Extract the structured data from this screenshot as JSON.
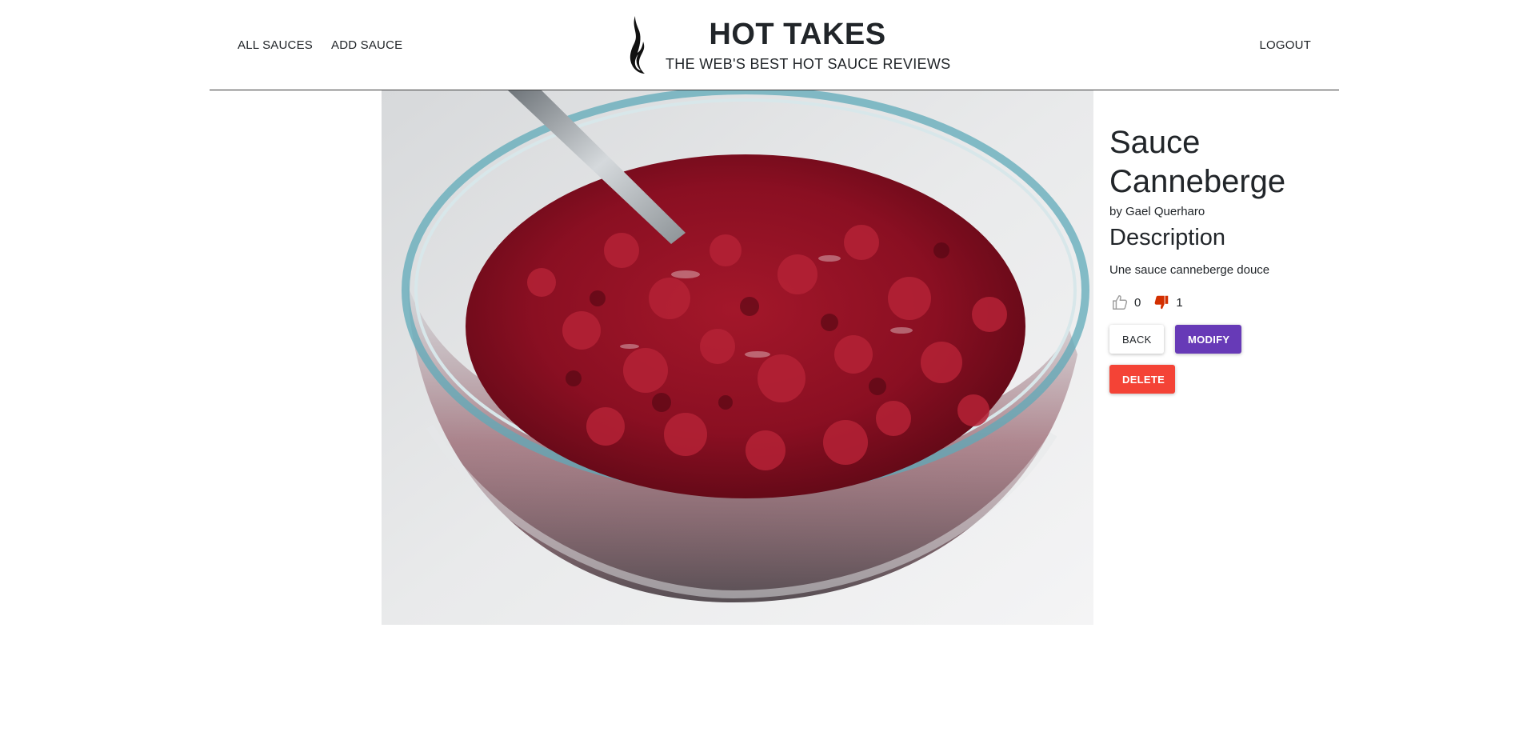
{
  "header": {
    "nav": {
      "all_sauces": "ALL SAUCES",
      "add_sauce": "ADD SAUCE",
      "logout": "LOGOUT"
    },
    "brand": {
      "title": "HOT TAKES",
      "subtitle": "THE WEB'S BEST HOT SAUCE REVIEWS",
      "logo_icon": "flame-icon"
    }
  },
  "sauce": {
    "image": "cranberry-sauce-bowl-photo",
    "name": "Sauce Canneberge",
    "author": "by Gael Querharo",
    "description_heading": "Description",
    "description": "Une sauce canneberge douce",
    "likes": {
      "icon": "thumbs-up-icon",
      "count": "0"
    },
    "dislikes": {
      "icon": "thumbs-down-icon",
      "count": "1",
      "active_color": "#d32f00"
    }
  },
  "actions": {
    "back_label": "BACK",
    "modify_label": "MODIFY",
    "delete_label": "DELETE"
  },
  "colors": {
    "modify": "#673ab7",
    "delete": "#f44336"
  }
}
